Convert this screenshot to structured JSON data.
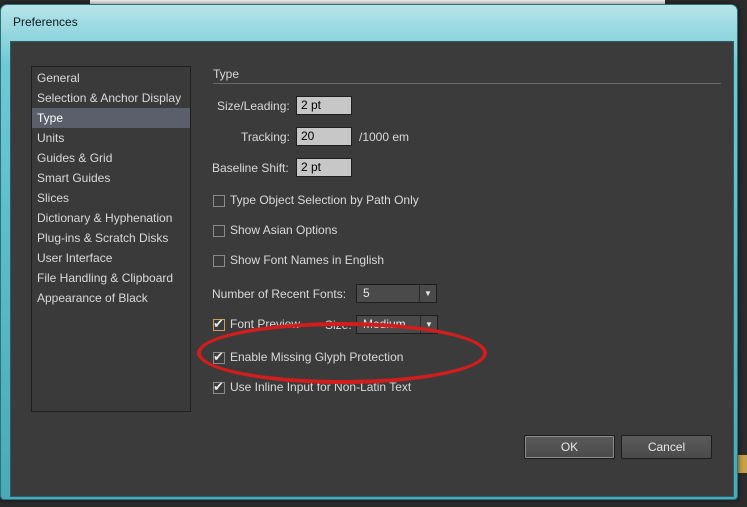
{
  "window": {
    "title": "Preferences"
  },
  "categories": [
    "General",
    "Selection & Anchor Display",
    "Type",
    "Units",
    "Guides & Grid",
    "Smart Guides",
    "Slices",
    "Dictionary & Hyphenation",
    "Plug-ins & Scratch Disks",
    "User Interface",
    "File Handling & Clipboard",
    "Appearance of Black"
  ],
  "selected_category": "Type",
  "type_panel": {
    "section_title": "Type",
    "size_leading_label": "Size/Leading:",
    "size_leading_value": "2 pt",
    "tracking_label": "Tracking:",
    "tracking_value": "20",
    "tracking_unit": "/1000 em",
    "baseline_shift_label": "Baseline Shift:",
    "baseline_shift_value": "2 pt",
    "checkboxes": {
      "type_object_selection": {
        "label": "Type Object Selection by Path Only",
        "checked": false
      },
      "show_asian_options": {
        "label": "Show Asian Options",
        "checked": false
      },
      "show_font_names_english": {
        "label": "Show Font Names in English",
        "checked": false
      },
      "font_preview": {
        "label": "Font Preview",
        "checked": true
      },
      "missing_glyph_protection": {
        "label": "Enable Missing Glyph Protection",
        "checked": true
      },
      "inline_input": {
        "label": "Use Inline Input for Non-Latin Text",
        "checked": true
      }
    },
    "recent_fonts_label": "Number of Recent Fonts:",
    "recent_fonts_value": "5",
    "font_preview_size_label": "Size:",
    "font_preview_size_value": "Medium"
  },
  "buttons": {
    "ok": "OK",
    "cancel": "Cancel"
  },
  "icons": {
    "checkmark": "check-icon",
    "dropdown": "chevron-down-icon"
  },
  "colors": {
    "annotation": "#d31d1d",
    "selected_row": "#5a5f6b",
    "window_frame": "#59bcc8"
  }
}
